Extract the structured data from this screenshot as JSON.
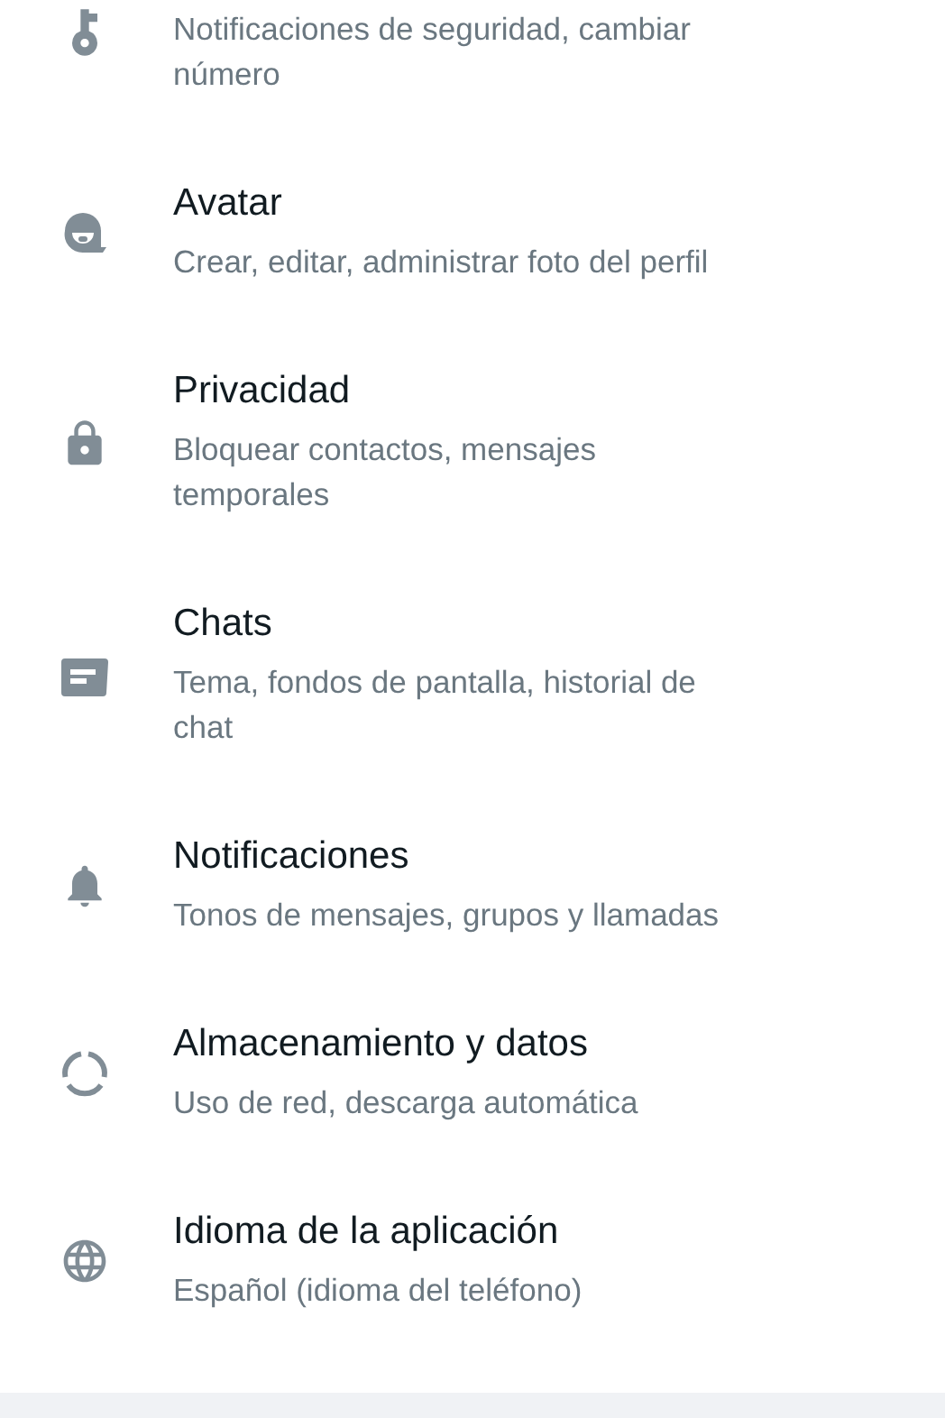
{
  "settings": [
    {
      "subtitle": "Notificaciones de seguridad, cambiar número"
    },
    {
      "title": "Avatar",
      "subtitle": "Crear, editar, administrar foto del perfil"
    },
    {
      "title": "Privacidad",
      "subtitle": "Bloquear contactos, mensajes temporales"
    },
    {
      "title": "Chats",
      "subtitle": "Tema, fondos de pantalla, historial de chat"
    },
    {
      "title": "Notificaciones",
      "subtitle": "Tonos de mensajes, grupos y llamadas"
    },
    {
      "title": "Almacenamiento y datos",
      "subtitle": "Uso de red, descarga automática"
    },
    {
      "title": "Idioma de la aplicación",
      "subtitle": "Español (idioma del teléfono)"
    }
  ]
}
